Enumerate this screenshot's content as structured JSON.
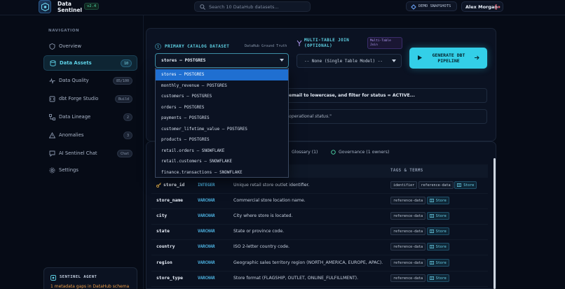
{
  "header": {
    "brand_line1": "Data",
    "brand_line2": "Sentinel",
    "version": "v2.4",
    "search_placeholder": "Search 10 DataHub datasets...",
    "demo_label": "DEMO SNAPSHOTS",
    "user_name": "Alex Morgan"
  },
  "sidebar": {
    "heading": "NAVIGATION",
    "items": [
      {
        "label": "Overview",
        "badge": "",
        "icon": "shield-icon"
      },
      {
        "label": "Data Assets",
        "badge": "10",
        "icon": "database-icon",
        "active": true
      },
      {
        "label": "Data Quality",
        "badge": "85/100",
        "icon": "pulse-icon"
      },
      {
        "label": "dbt Forge Studio",
        "badge": "Build",
        "icon": "code-icon"
      },
      {
        "label": "Data Lineage",
        "badge": "2",
        "icon": "lineage-icon"
      },
      {
        "label": "Anomalies",
        "badge": "3",
        "icon": "warning-icon"
      },
      {
        "label": "AI Sentinel Chat",
        "badge": "Chat",
        "icon": "chat-icon"
      },
      {
        "label": "Settings",
        "badge": "",
        "icon": "gear-icon"
      }
    ],
    "agent": {
      "title": "SENTINEL AGENT",
      "warning": "1 metadata gaps in DataHub schema"
    }
  },
  "builder": {
    "step": "1",
    "primary_label": "PRIMARY CATALOG DATASET",
    "ground_truth": "DataHub Ground Truth",
    "primary_value": "stores — POSTGRES",
    "join_label_line1": "MULTI-TABLE JOIN",
    "join_label_line2": "(OPTIONAL)",
    "join_badge": "Multi-Table Join",
    "join_value": "-- None (Single Table Model) --",
    "generate_label": "GENERATE DBT PIPELINE",
    "instruction_visible": "email to lowercase, and filter for status = ACTIVE...",
    "description_visible": "operational status.\""
  },
  "dropdown": {
    "options": [
      "stores — POSTGRES",
      "monthly_revenue — POSTGRES",
      "customers — POSTGRES",
      "orders — POSTGRES",
      "payments — POSTGRES",
      "customer_lifetime_value — POSTGRES",
      "products — POSTGRES",
      "retail.orders — SNOWFLAKE",
      "retail.customers — SNOWFLAKE",
      "finance.transactions — SNOWFLAKE"
    ],
    "selected_index": 0
  },
  "schema": {
    "tabs": {
      "glossary": "Glossary (1)",
      "governance": "Governance (1 owners)"
    },
    "tags_header": "TAGS & TERMS",
    "rows": [
      {
        "name": "store_id",
        "type": "INTEGER",
        "desc": "Unique retail store outlet identifier.",
        "tags": [
          "identifier",
          "reference-data"
        ],
        "term": "Store",
        "key": true
      },
      {
        "name": "store_name",
        "type": "VARCHAR",
        "desc": "Commercial store location name.",
        "tags": [
          "reference-data"
        ],
        "term": "Store"
      },
      {
        "name": "city",
        "type": "VARCHAR",
        "desc": "City where store is located.",
        "tags": [
          "reference-data"
        ],
        "term": "Store"
      },
      {
        "name": "state",
        "type": "VARCHAR",
        "desc": "State or province code.",
        "tags": [
          "reference-data"
        ],
        "term": "Store"
      },
      {
        "name": "country",
        "type": "VARCHAR",
        "desc": "ISO 2-letter country code.",
        "tags": [
          "reference-data"
        ],
        "term": "Store"
      },
      {
        "name": "region",
        "type": "VARCHAR",
        "desc": "Geographic sales territory region (NORTH_AMERICA, EUROPE, APAC).",
        "tags": [
          "reference-data"
        ],
        "term": "Store"
      },
      {
        "name": "store_type",
        "type": "VARCHAR",
        "desc": "Store format (FLAGSHIP, OUTLET, ONLINE_FULFILLMENT).",
        "tags": [
          "reference-data"
        ],
        "term": "Store"
      }
    ]
  },
  "colors": {
    "accent": "#33cfe8",
    "selected": "#1f6fd1",
    "warning": "#f0a04b"
  }
}
